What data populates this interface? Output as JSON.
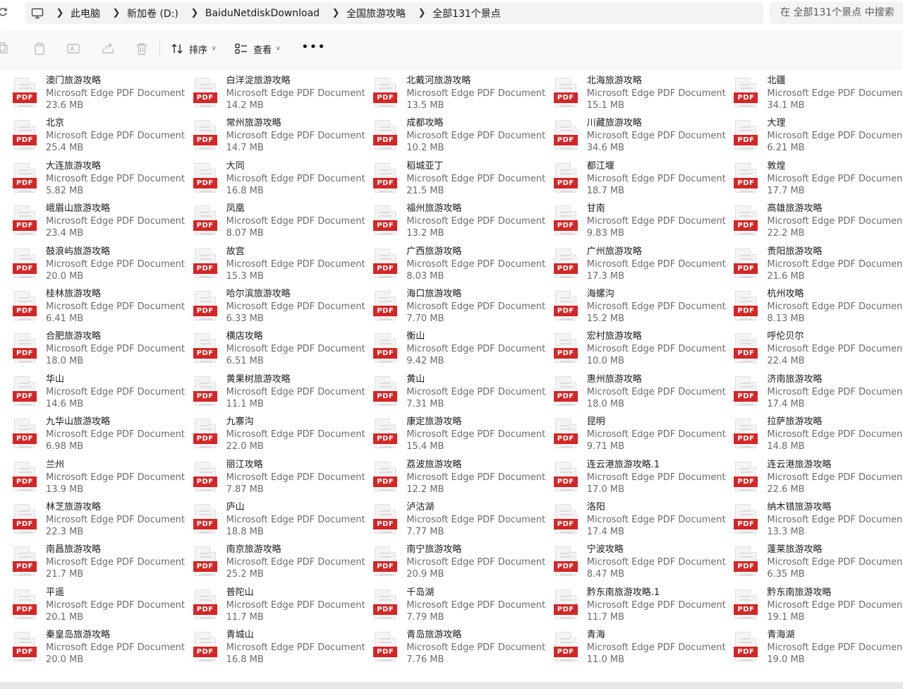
{
  "breadcrumb": {
    "items": [
      "此电脑",
      "新加卷 (D:)",
      "BaiduNetdiskDownload",
      "全国旅游攻略",
      "全部131个景点"
    ]
  },
  "search": {
    "placeholder": "在 全部131个景点 中搜索"
  },
  "toolbar": {
    "sort_label": "排序",
    "view_label": "查看",
    "more_label": "•••",
    "disabled_icons": [
      "copy-icon",
      "paste-icon",
      "rename-icon",
      "share-icon",
      "delete-icon"
    ]
  },
  "file_type_badge": "PDF",
  "files": [
    {
      "name": "澳门旅游攻略",
      "type": "Microsoft Edge PDF Document",
      "size": "23.6 MB"
    },
    {
      "name": "白洋淀旅游攻略",
      "type": "Microsoft Edge PDF Document",
      "size": "14.2 MB"
    },
    {
      "name": "北戴河旅游攻略",
      "type": "Microsoft Edge PDF Document",
      "size": "13.5 MB"
    },
    {
      "name": "北海旅游攻略",
      "type": "Microsoft Edge PDF Document",
      "size": "15.1 MB"
    },
    {
      "name": "北疆",
      "type": "Microsoft Edge PDF Document",
      "size": "34.1 MB"
    },
    {
      "name": "北京",
      "type": "Microsoft Edge PDF Document",
      "size": "25.4 MB"
    },
    {
      "name": "常州旅游攻略",
      "type": "Microsoft Edge PDF Document",
      "size": "14.7 MB"
    },
    {
      "name": "成都攻略",
      "type": "Microsoft Edge PDF Document",
      "size": "10.2 MB"
    },
    {
      "name": "川藏旅游攻略",
      "type": "Microsoft Edge PDF Document",
      "size": "34.6 MB"
    },
    {
      "name": "大理",
      "type": "Microsoft Edge PDF Document",
      "size": "6.21 MB"
    },
    {
      "name": "大连旅游攻略",
      "type": "Microsoft Edge PDF Document",
      "size": "5.82 MB"
    },
    {
      "name": "大同",
      "type": "Microsoft Edge PDF Document",
      "size": "16.8 MB"
    },
    {
      "name": "稻城亚丁",
      "type": "Microsoft Edge PDF Document",
      "size": "21.5 MB"
    },
    {
      "name": "都江堰",
      "type": "Microsoft Edge PDF Document",
      "size": "18.7 MB"
    },
    {
      "name": "敦煌",
      "type": "Microsoft Edge PDF Document",
      "size": "17.7 MB"
    },
    {
      "name": "峨眉山旅游攻略",
      "type": "Microsoft Edge PDF Document",
      "size": "23.4 MB"
    },
    {
      "name": "凤凰",
      "type": "Microsoft Edge PDF Document",
      "size": "8.07 MB"
    },
    {
      "name": "福州旅游攻略",
      "type": "Microsoft Edge PDF Document",
      "size": "13.2 MB"
    },
    {
      "name": "甘南",
      "type": "Microsoft Edge PDF Document",
      "size": "9.83 MB"
    },
    {
      "name": "高雄旅游攻略",
      "type": "Microsoft Edge PDF Document",
      "size": "22.2 MB"
    },
    {
      "name": "鼓浪屿旅游攻略",
      "type": "Microsoft Edge PDF Document",
      "size": "20.0 MB"
    },
    {
      "name": "故宫",
      "type": "Microsoft Edge PDF Document",
      "size": "15.3 MB"
    },
    {
      "name": "广西旅游攻略",
      "type": "Microsoft Edge PDF Document",
      "size": "8.03 MB"
    },
    {
      "name": "广州旅游攻略",
      "type": "Microsoft Edge PDF Document",
      "size": "17.3 MB"
    },
    {
      "name": "贵阳旅游攻略",
      "type": "Microsoft Edge PDF Document",
      "size": "21.6 MB"
    },
    {
      "name": "桂林旅游攻略",
      "type": "Microsoft Edge PDF Document",
      "size": "6.41 MB"
    },
    {
      "name": "哈尔滨旅游攻略",
      "type": "Microsoft Edge PDF Document",
      "size": "6.33 MB"
    },
    {
      "name": "海口旅游攻略",
      "type": "Microsoft Edge PDF Document",
      "size": "7.70 MB"
    },
    {
      "name": "海螺沟",
      "type": "Microsoft Edge PDF Document",
      "size": "15.2 MB"
    },
    {
      "name": "杭州攻略",
      "type": "Microsoft Edge PDF Document",
      "size": "8.13 MB"
    },
    {
      "name": "合肥旅游攻略",
      "type": "Microsoft Edge PDF Document",
      "size": "18.0 MB"
    },
    {
      "name": "横店攻略",
      "type": "Microsoft Edge PDF Document",
      "size": "6.51 MB"
    },
    {
      "name": "衡山",
      "type": "Microsoft Edge PDF Document",
      "size": "9.42 MB"
    },
    {
      "name": "宏村旅游攻略",
      "type": "Microsoft Edge PDF Document",
      "size": "10.0 MB"
    },
    {
      "name": "呼伦贝尔",
      "type": "Microsoft Edge PDF Document",
      "size": "22.4 MB"
    },
    {
      "name": "华山",
      "type": "Microsoft Edge PDF Document",
      "size": "14.6 MB"
    },
    {
      "name": "黄果树旅游攻略",
      "type": "Microsoft Edge PDF Document",
      "size": "11.1 MB"
    },
    {
      "name": "黄山",
      "type": "Microsoft Edge PDF Document",
      "size": "7.31 MB"
    },
    {
      "name": "惠州旅游攻略",
      "type": "Microsoft Edge PDF Document",
      "size": "18.0 MB"
    },
    {
      "name": "济南旅游攻略",
      "type": "Microsoft Edge PDF Document",
      "size": "17.4 MB"
    },
    {
      "name": "九华山旅游攻略",
      "type": "Microsoft Edge PDF Document",
      "size": "6.98 MB"
    },
    {
      "name": "九寨沟",
      "type": "Microsoft Edge PDF Document",
      "size": "22.0 MB"
    },
    {
      "name": "康定旅游攻略",
      "type": "Microsoft Edge PDF Document",
      "size": "15.4 MB"
    },
    {
      "name": "昆明",
      "type": "Microsoft Edge PDF Document",
      "size": "9.71 MB"
    },
    {
      "name": "拉萨旅游攻略",
      "type": "Microsoft Edge PDF Document",
      "size": "14.8 MB"
    },
    {
      "name": "兰州",
      "type": "Microsoft Edge PDF Document",
      "size": "13.9 MB"
    },
    {
      "name": "丽江攻略",
      "type": "Microsoft Edge PDF Document",
      "size": "7.87 MB"
    },
    {
      "name": "荔波旅游攻略",
      "type": "Microsoft Edge PDF Document",
      "size": "12.2 MB"
    },
    {
      "name": "连云港旅游攻略.1",
      "type": "Microsoft Edge PDF Document",
      "size": "17.0 MB"
    },
    {
      "name": "连云港旅游攻略",
      "type": "Microsoft Edge PDF Document",
      "size": "22.6 MB"
    },
    {
      "name": "林芝旅游攻略",
      "type": "Microsoft Edge PDF Document",
      "size": "22.3 MB"
    },
    {
      "name": "庐山",
      "type": "Microsoft Edge PDF Document",
      "size": "18.8 MB"
    },
    {
      "name": "泸沽湖",
      "type": "Microsoft Edge PDF Document",
      "size": "7.77 MB"
    },
    {
      "name": "洛阳",
      "type": "Microsoft Edge PDF Document",
      "size": "17.4 MB"
    },
    {
      "name": "纳木错旅游攻略",
      "type": "Microsoft Edge PDF Document",
      "size": "13.3 MB"
    },
    {
      "name": "南昌旅游攻略",
      "type": "Microsoft Edge PDF Document",
      "size": "21.7 MB"
    },
    {
      "name": "南京旅游攻略",
      "type": "Microsoft Edge PDF Document",
      "size": "25.2 MB"
    },
    {
      "name": "南宁旅游攻略",
      "type": "Microsoft Edge PDF Document",
      "size": "20.9 MB"
    },
    {
      "name": "宁波攻略",
      "type": "Microsoft Edge PDF Document",
      "size": "8.47 MB"
    },
    {
      "name": "蓬莱旅游攻略",
      "type": "Microsoft Edge PDF Document",
      "size": "6.35 MB"
    },
    {
      "name": "平遥",
      "type": "Microsoft Edge PDF Document",
      "size": "20.1 MB"
    },
    {
      "name": "普陀山",
      "type": "Microsoft Edge PDF Document",
      "size": "11.7 MB"
    },
    {
      "name": "千岛湖",
      "type": "Microsoft Edge PDF Document",
      "size": "7.79 MB"
    },
    {
      "name": "黔东南旅游攻略.1",
      "type": "Microsoft Edge PDF Document",
      "size": "11.7 MB"
    },
    {
      "name": "黔东南旅游攻略",
      "type": "Microsoft Edge PDF Document",
      "size": "19.1 MB"
    },
    {
      "name": "秦皇岛旅游攻略",
      "type": "Microsoft Edge PDF Document",
      "size": "20.0 MB"
    },
    {
      "name": "青城山",
      "type": "Microsoft Edge PDF Document",
      "size": "16.8 MB"
    },
    {
      "name": "青岛旅游攻略",
      "type": "Microsoft Edge PDF Document",
      "size": "7.76 MB"
    },
    {
      "name": "青海",
      "type": "Microsoft Edge PDF Document",
      "size": "11.0 MB"
    },
    {
      "name": "青海湖",
      "type": "Microsoft Edge PDF Document",
      "size": "19.0 MB"
    }
  ]
}
